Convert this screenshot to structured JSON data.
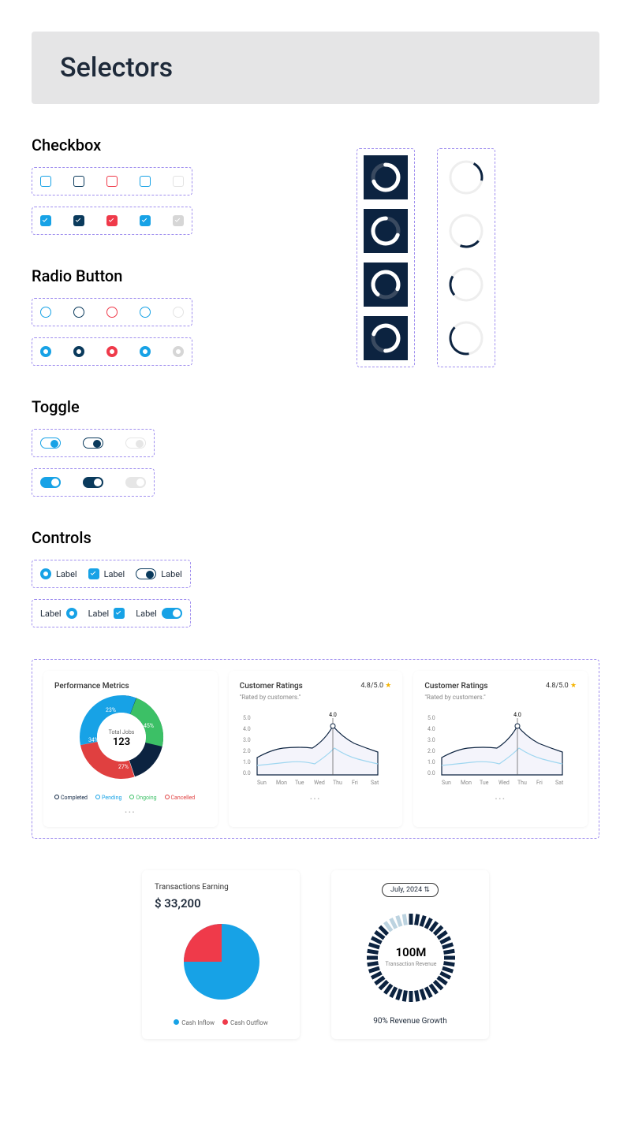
{
  "header": {
    "title": "Selectors"
  },
  "sections": {
    "checkbox": "Checkbox",
    "radio": "Radio Button",
    "toggle": "Toggle",
    "controls": "Controls"
  },
  "controls": {
    "label": "Label"
  },
  "cards": {
    "perf": {
      "title": "Performance Metrics",
      "center_label": "Total Jobs",
      "center_value": "123",
      "legend": [
        "Completed",
        "Pending",
        "Ongoing",
        "Cancelled"
      ]
    },
    "rating": {
      "title": "Customer Ratings",
      "subtitle": "\"Rated by customers.\"",
      "score": "4.8/5.0",
      "peak": "4.0",
      "y": [
        "5.0",
        "4.0",
        "3.0",
        "2.0",
        "1.0",
        "0.0"
      ],
      "x": [
        "Sun",
        "Mon",
        "Tue",
        "Wed",
        "Thu",
        "Fri",
        "Sat"
      ]
    }
  },
  "bcards": {
    "trans": {
      "title": "Transactions Earning",
      "value": "$ 33,200",
      "legend": [
        "Cash Inflow",
        "Cash Outflow"
      ]
    },
    "rev": {
      "date": "July, 2024",
      "val": "100M",
      "label": "Transaction Revenue",
      "growth": "90% Revenue Growth"
    }
  },
  "chart_data": [
    {
      "type": "pie",
      "title": "Performance Metrics",
      "series": [
        {
          "name": "Completed",
          "value": 45,
          "color": "#0c2340"
        },
        {
          "name": "Cancelled",
          "value": 27,
          "color": "#e04040"
        },
        {
          "name": "Pending",
          "value": 34,
          "color": "#17a2e6"
        },
        {
          "name": "Ongoing",
          "value": 23,
          "color": "#3cc066"
        }
      ],
      "center_label": "Total Jobs",
      "center_value": 123
    },
    {
      "type": "line",
      "title": "Customer Ratings",
      "subtitle": "Rated by customers.",
      "ylabel": "",
      "xlabel": "",
      "categories": [
        "Sun",
        "Mon",
        "Tue",
        "Wed",
        "Thu",
        "Fri",
        "Sat"
      ],
      "series": [
        {
          "name": "dark",
          "values": [
            1.5,
            2.0,
            2.3,
            2.2,
            4.0,
            3.2,
            2.5
          ]
        },
        {
          "name": "light",
          "values": [
            0.9,
            1.0,
            1.1,
            1.0,
            1.8,
            1.4,
            1.1
          ]
        }
      ],
      "ylim": [
        0,
        5
      ],
      "peak_label": "4.0",
      "rating": "4.8/5.0"
    },
    {
      "type": "pie",
      "title": "Transactions Earning",
      "total": "$ 33,200",
      "series": [
        {
          "name": "Cash Inflow",
          "value": 75,
          "color": "#17a2e6"
        },
        {
          "name": "Cash Outflow",
          "value": 25,
          "color": "#ef3a4a"
        }
      ]
    },
    {
      "type": "area",
      "title": "Transaction Revenue",
      "date": "July, 2024",
      "center_value": "100M",
      "growth_pct": 90,
      "growth_label": "90% Revenue Growth"
    }
  ]
}
